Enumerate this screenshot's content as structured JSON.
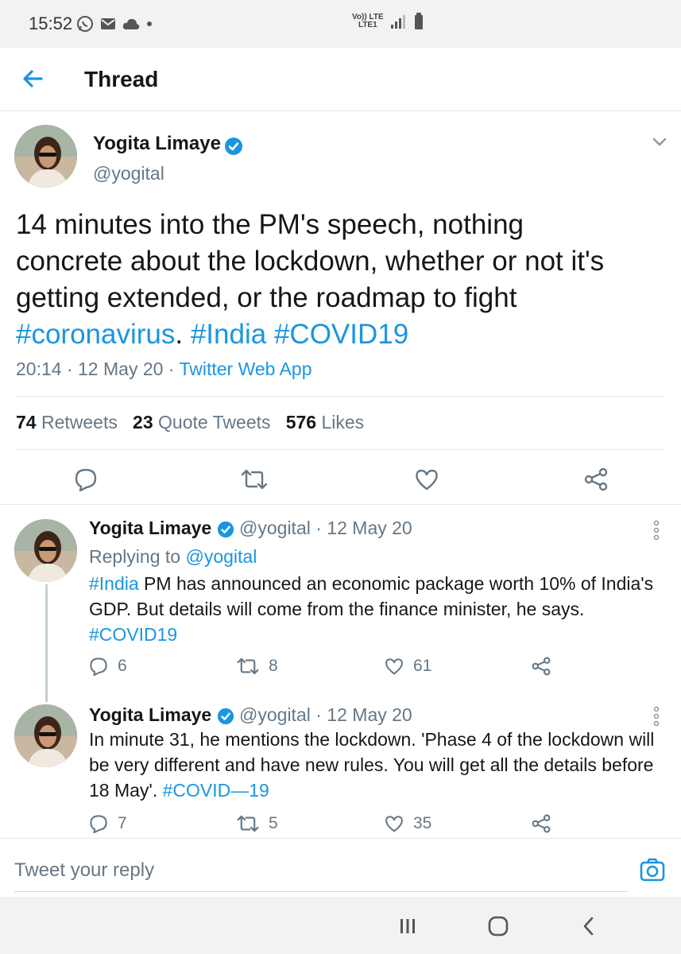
{
  "status_bar": {
    "time": "15:52",
    "network_line1": "Vo)) LTE",
    "network_line2": "LTE1"
  },
  "header": {
    "title": "Thread"
  },
  "main_tweet": {
    "author": "Yogita Limaye",
    "handle": "@yogital",
    "text_plain": "14 minutes into the PM's speech, nothing concrete about the lockdown, whether or not it's getting extended, or the roadmap to fight ",
    "hashtag1": "#coronavirus",
    "sep": ". ",
    "hashtag2": "#India",
    "hashtag3": "#COVID19",
    "time": "20:14",
    "date": "12 May 20",
    "source": "Twitter Web App",
    "retweets_count": "74",
    "retweets_label": "Retweets",
    "quotes_count": "23",
    "quotes_label": "Quote Tweets",
    "likes_count": "576",
    "likes_label": "Likes"
  },
  "replies": [
    {
      "author": "Yogita Limaye",
      "handle": "@yogital",
      "date": "12 May 20",
      "replying_to_label": "Replying to",
      "replying_to_handle": "@yogital",
      "hashtag_lead": "#India",
      "text": " PM has announced an economic package worth 10% of India's GDP. But details will come from the finance minister, he says. ",
      "hashtag_tail": "#COVID19",
      "replies": "6",
      "retweets": "8",
      "likes": "61"
    },
    {
      "author": "Yogita Limaye",
      "handle": "@yogital",
      "date": "12 May 20",
      "text": "In minute 31, he mentions the lockdown. 'Phase 4 of the lockdown will be very different and have new rules. You will get all the details before 18 May'. ",
      "hashtag_tail": "#COVID—19",
      "replies": "7",
      "retweets": "5",
      "likes": "35"
    }
  ],
  "reply_bar": {
    "placeholder": "Tweet your reply"
  },
  "icons": {
    "back": "back-arrow-icon",
    "verified": "verified-badge-icon",
    "chevron": "chevron-down-icon",
    "reply": "reply-icon",
    "retweet": "retweet-icon",
    "like": "heart-icon",
    "share": "share-icon",
    "camera": "camera-icon",
    "more": "more-vertical-icon"
  },
  "colors": {
    "accent": "#1b95e0",
    "text": "#14171a",
    "muted": "#657786",
    "divider": "#e1e8ed"
  }
}
